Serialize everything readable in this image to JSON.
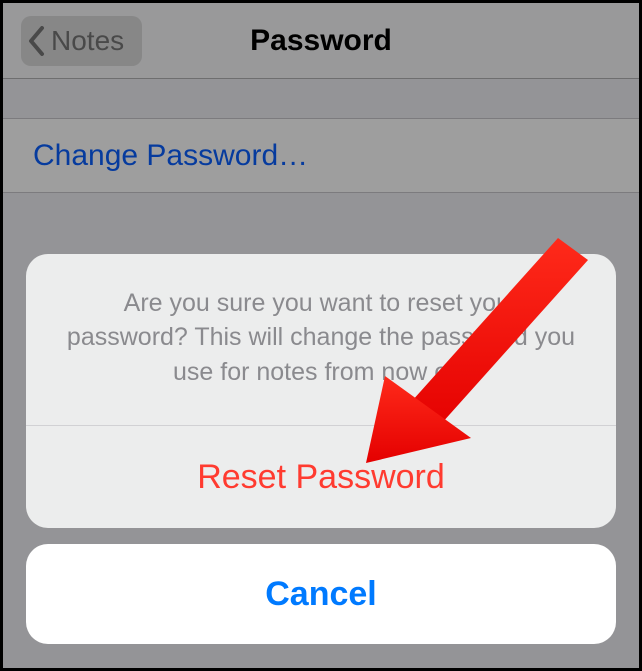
{
  "nav": {
    "back_label": "Notes",
    "title": "Password"
  },
  "list": {
    "change_password_label": "Change Password…"
  },
  "sheet": {
    "message": "Are you sure you want to reset your password? This will change the password you use for notes from now on.",
    "action_label": "Reset Password",
    "cancel_label": "Cancel"
  },
  "colors": {
    "destructive": "#ff3b30",
    "tint": "#007aff",
    "arrow": "#fe0000"
  }
}
